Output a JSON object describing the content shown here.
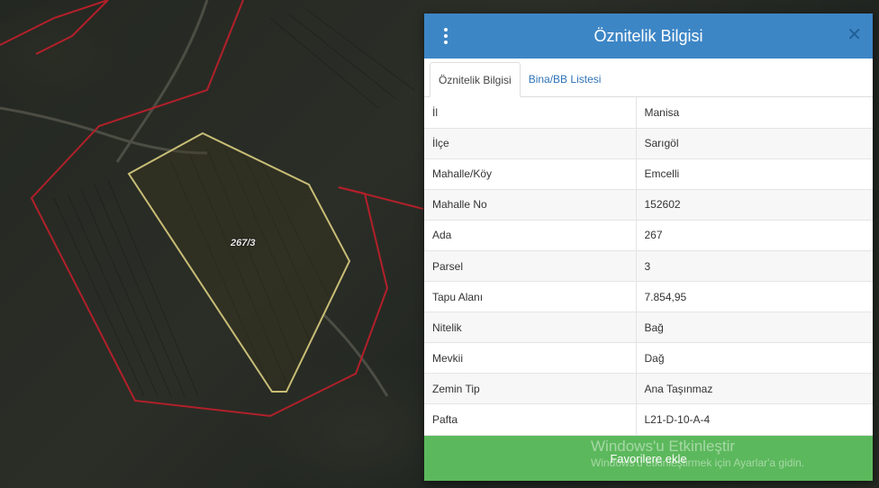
{
  "map": {
    "parcel_label": "267/3"
  },
  "panel": {
    "title": "Öznitelik Bilgisi",
    "tabs": [
      {
        "label": "Öznitelik Bilgisi",
        "active": true
      },
      {
        "label": "Bina/BB Listesi",
        "active": false
      }
    ],
    "rows": [
      {
        "key": "İl",
        "value": "Manisa"
      },
      {
        "key": "İlçe",
        "value": "Sarıgöl"
      },
      {
        "key": "Mahalle/Köy",
        "value": "Emcelli"
      },
      {
        "key": "Mahalle No",
        "value": "152602"
      },
      {
        "key": "Ada",
        "value": "267"
      },
      {
        "key": "Parsel",
        "value": "3"
      },
      {
        "key": "Tapu Alanı",
        "value": "7.854,95"
      },
      {
        "key": "Nitelik",
        "value": "Bağ"
      },
      {
        "key": "Mevkii",
        "value": "Dağ"
      },
      {
        "key": "Zemin Tip",
        "value": "Ana Taşınmaz"
      },
      {
        "key": "Pafta",
        "value": "L21-D-10-A-4"
      }
    ],
    "favorite_button_label": "Favorilere ekle",
    "close_icon": "close-icon",
    "menu_icon": "vertical-dots-icon",
    "header_color": "#3d86c6",
    "button_color": "#5cb85c"
  },
  "watermark": {
    "line1": "Windows'u Etkinleştir",
    "line2": "Windows'u etkinleştirmek için Ayarlar'a gidin."
  }
}
